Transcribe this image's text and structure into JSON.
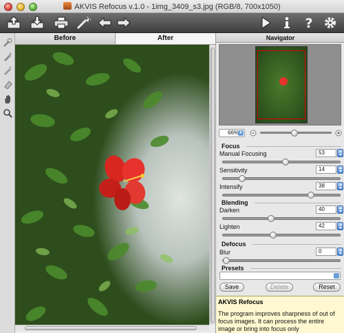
{
  "window": {
    "title": "AKVIS Refocus v.1.0 - 1img_3409_s3.jpg (RGB/8, 700x1050)"
  },
  "toolbar": {
    "left_icons": [
      "open-icon",
      "save-icon",
      "print-icon",
      "wand-icon",
      "undo-icon",
      "redo-icon"
    ],
    "right_icons": [
      "run-icon",
      "info-icon",
      "help-icon",
      "settings-icon"
    ]
  },
  "tools": [
    "refocus-area-icon",
    "keep-area-icon",
    "background-area-icon",
    "eraser-icon",
    "hand-icon",
    "zoom-icon"
  ],
  "tabs": {
    "before": "Before",
    "after": "After"
  },
  "navigator": {
    "title": "Navigator",
    "zoom": "66%"
  },
  "focus": {
    "title": "Focus",
    "params": [
      {
        "label": "Manual Focusing",
        "value": "53",
        "level": 0.53
      },
      {
        "label": "Sensitivity",
        "value": "14",
        "level": 0.14
      },
      {
        "label": "Intensify",
        "value": "38",
        "level": 0.76
      }
    ]
  },
  "blending": {
    "title": "Blending",
    "params": [
      {
        "label": "Darken",
        "value": "40",
        "level": 0.4
      },
      {
        "label": "Lighten",
        "value": "42",
        "level": 0.42
      }
    ]
  },
  "defocus": {
    "title": "Defocus",
    "params": [
      {
        "label": "Blur",
        "value": "0",
        "level": 0.0
      }
    ]
  },
  "presets": {
    "title": "Presets",
    "save": "Save",
    "delete": "Delete",
    "reset": "Reset"
  },
  "help": {
    "title": "AKVIS Refocus",
    "text": "The program improves sharpness of out of focus images. It can process the entire image or bring into focus only"
  },
  "colors": {
    "toolbar": "#4a4a4a",
    "help_bg": "#fff8d0",
    "flower": "#e8322d",
    "accent_blue": "#4a87d6"
  }
}
